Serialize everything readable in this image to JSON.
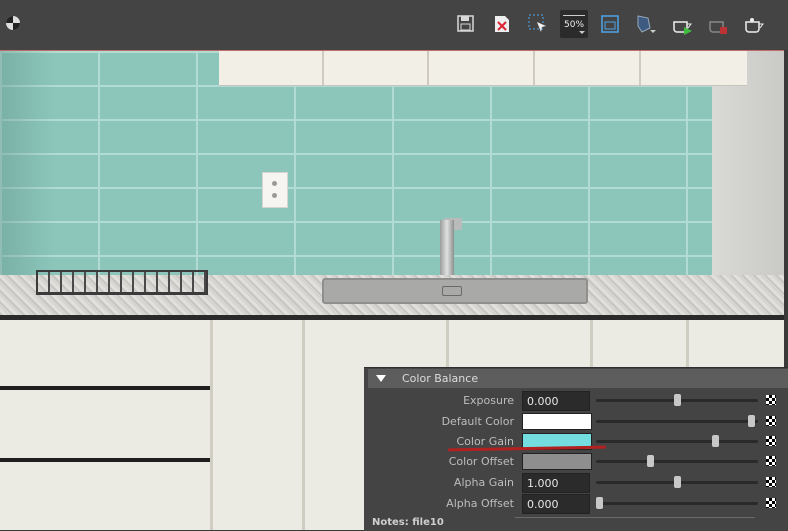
{
  "toolbar": {
    "items": [
      {
        "name": "save-image-icon"
      },
      {
        "name": "remove-image-icon"
      },
      {
        "name": "region-select-icon"
      },
      {
        "name": "zoom-icon",
        "label": "50%"
      },
      {
        "name": "display-frame-icon"
      },
      {
        "name": "render-options-icon"
      },
      {
        "name": "render-teapot-icon"
      },
      {
        "name": "stop-render-teapot-icon"
      },
      {
        "name": "ipr-teapot-icon"
      }
    ]
  },
  "panel": {
    "section_title": "Color Balance",
    "rows": [
      {
        "label": "Exposure",
        "type": "number",
        "value": "0.000",
        "slider": 0.5
      },
      {
        "label": "Default Color",
        "type": "color",
        "color": "#ffffff",
        "slider": 0.98
      },
      {
        "label": "Color Gain",
        "type": "color",
        "color": "#74dde0",
        "slider": 0.75
      },
      {
        "label": "Color Offset",
        "type": "color",
        "color": "#8e8e8e",
        "slider": 0.33
      },
      {
        "label": "Alpha Gain",
        "type": "number",
        "value": "1.000",
        "slider": 0.5
      },
      {
        "label": "Alpha Offset",
        "type": "number",
        "value": "0.000",
        "slider": 0.0
      }
    ],
    "notes_label": "Notes:  file10"
  },
  "annotation": {
    "color": "#b32020"
  }
}
